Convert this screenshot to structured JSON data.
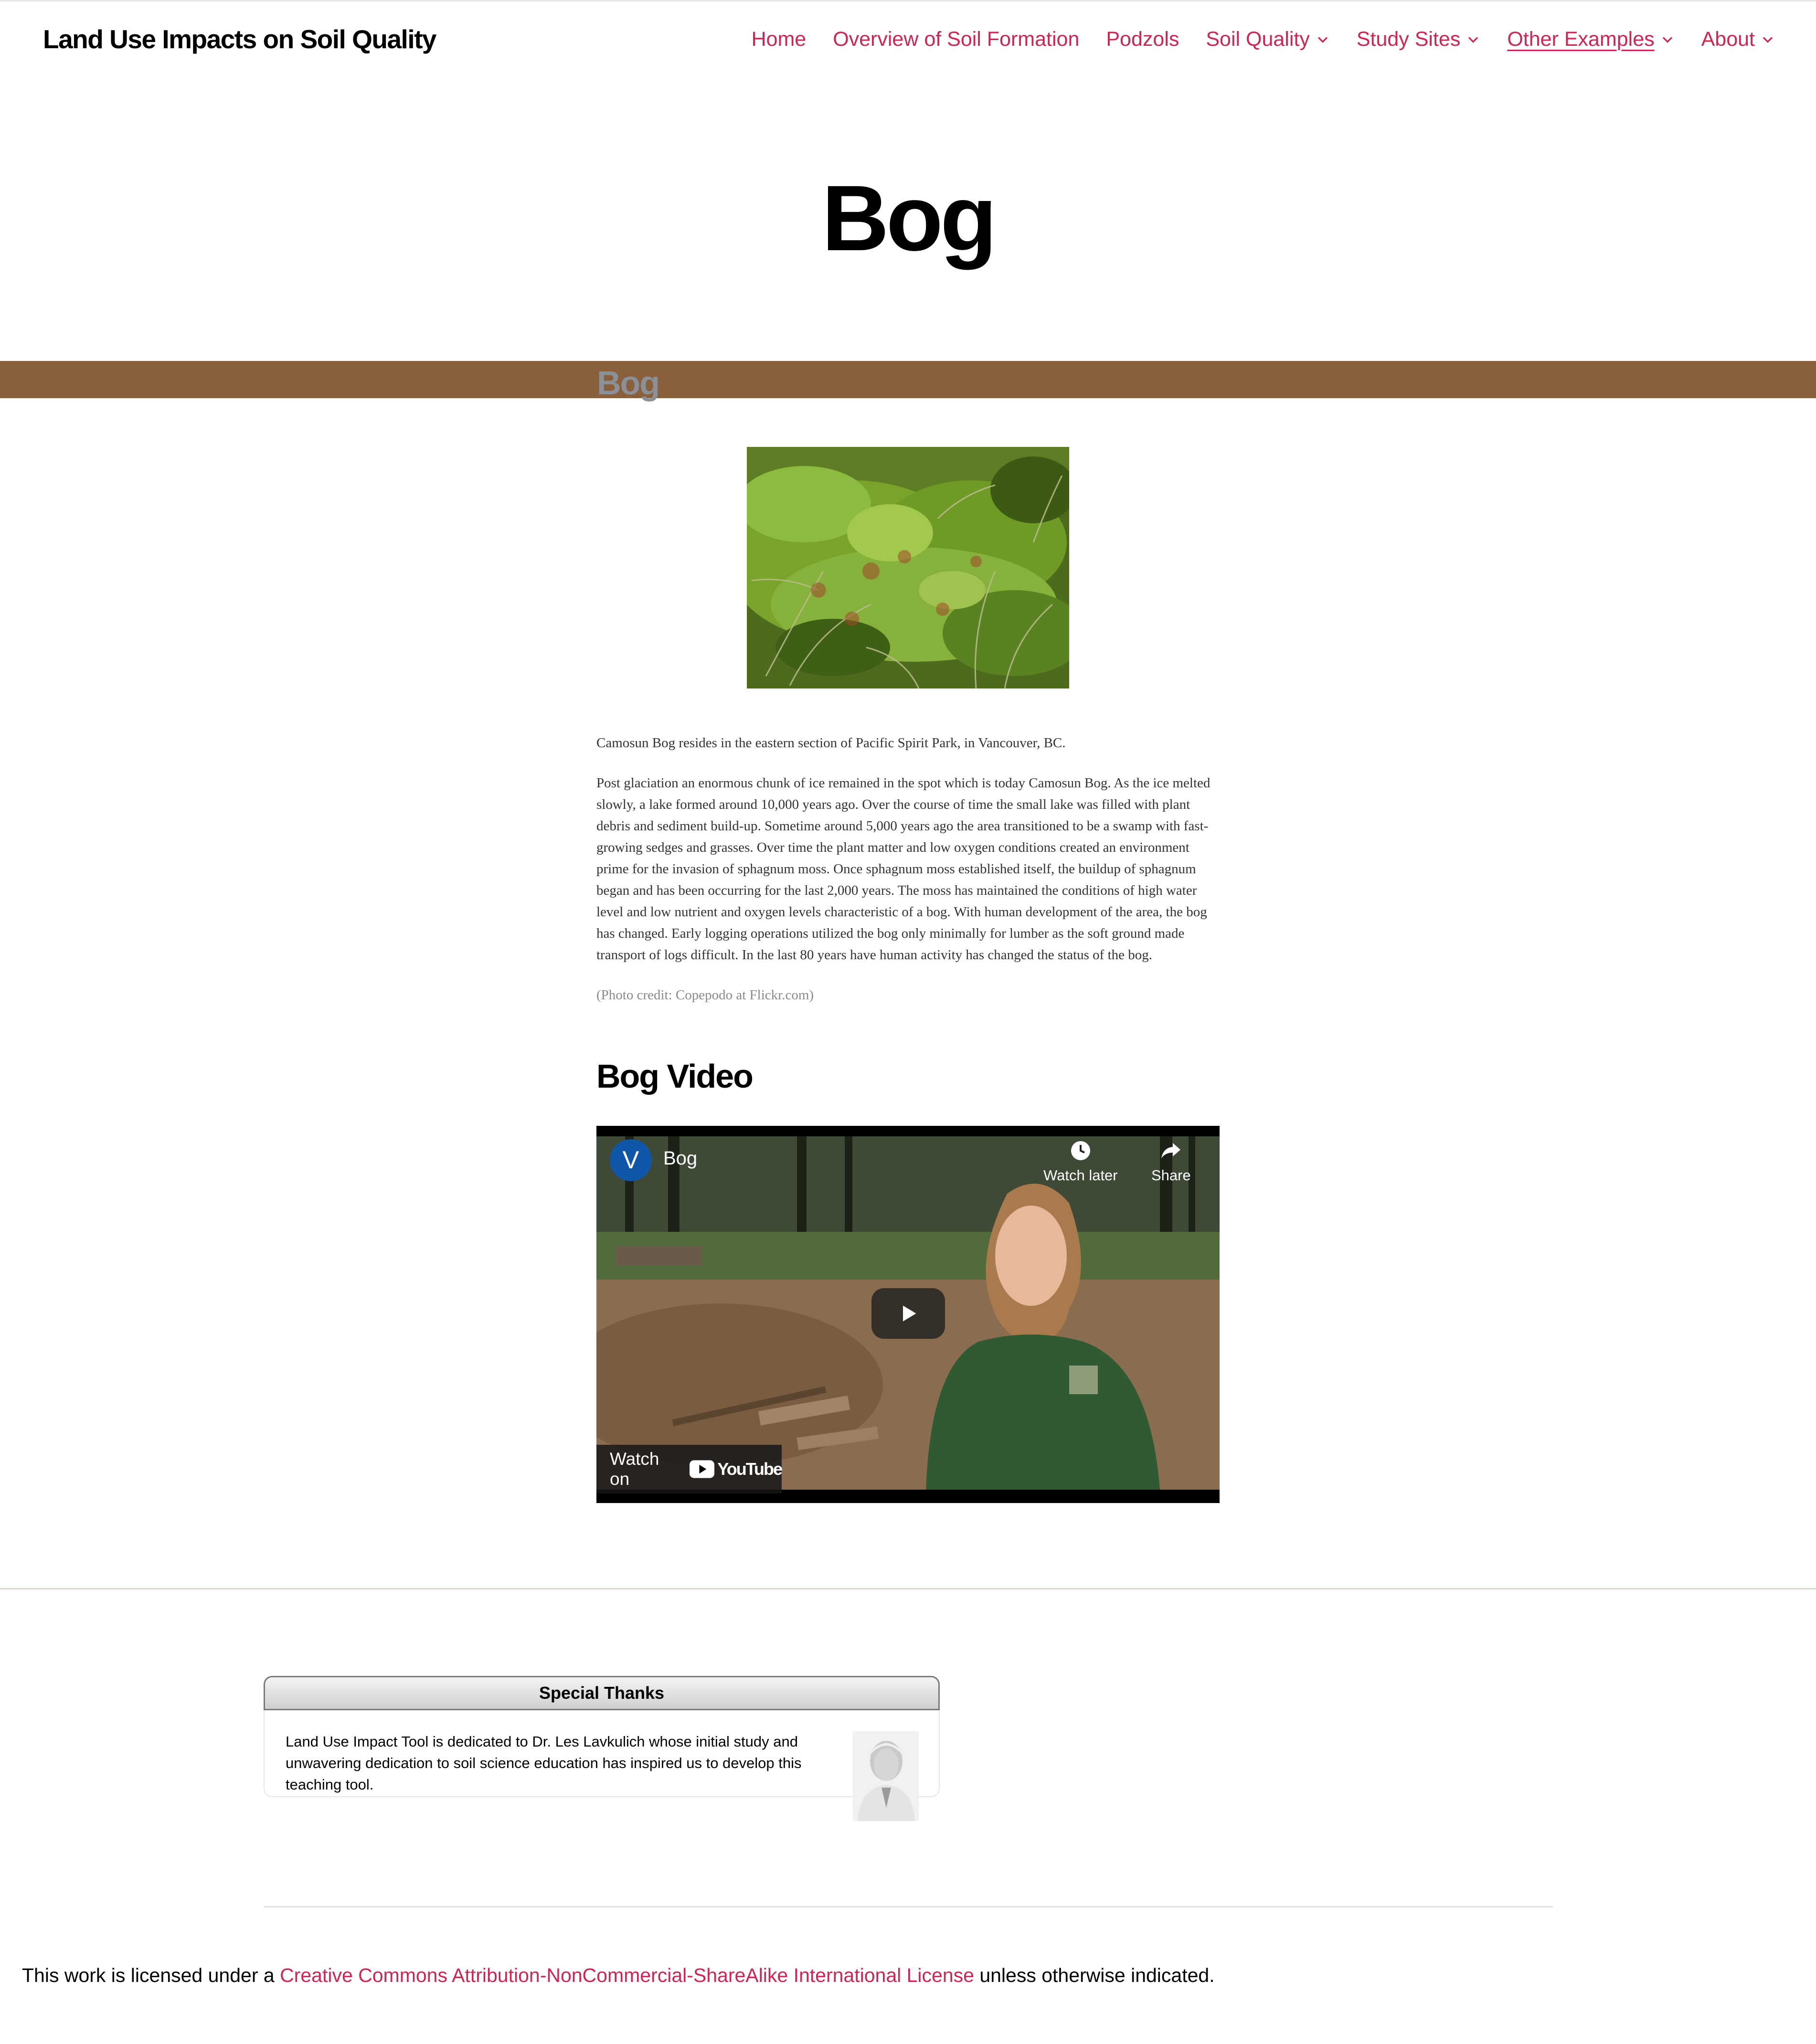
{
  "site": {
    "title": "Land Use Impacts on Soil Quality"
  },
  "nav": {
    "items": [
      {
        "label": "Home",
        "has_dropdown": false
      },
      {
        "label": "Overview of Soil Formation",
        "has_dropdown": false
      },
      {
        "label": "Podzols",
        "has_dropdown": false
      },
      {
        "label": "Soil Quality",
        "has_dropdown": true
      },
      {
        "label": "Study Sites",
        "has_dropdown": true
      },
      {
        "label": "Other Examples",
        "has_dropdown": true,
        "active": true
      },
      {
        "label": "About",
        "has_dropdown": true
      }
    ],
    "accent_color": "#cd2653"
  },
  "page": {
    "title": "Bog",
    "band_heading": "Bog",
    "band_color": "#8a5f3b"
  },
  "content": {
    "p1": "Camosun Bog resides in the eastern section of Pacific Spirit Park, in Vancouver, BC.",
    "p2": "Post glaciation an enormous chunk of ice remained in the spot which is today Camosun Bog. As the ice melted slowly, a lake formed around 10,000 years ago. Over the course of time the small lake was filled with plant debris and sediment build-up.  Sometime around 5,000 years ago the area transitioned to be a swamp with fast-growing sedges and grasses. Over time the plant matter and low oxygen conditions created an environment prime for the invasion of sphagnum moss. Once sphagnum moss established itself, the buildup of sphagnum began and has been occurring for the last 2,000 years.  The moss has maintained the conditions of high water level and low nutrient and oxygen levels characteristic of a bog. With human development of the area, the bog has changed.  Early logging operations utilized the bog only minimally for lumber as the soft ground made transport of logs difficult.  In the last 80 years have human activity has changed the status of the bog.",
    "photo_credit": "(Photo credit: Copepodo at Flickr.com)",
    "video_heading": "Bog Video"
  },
  "video": {
    "channel_initial": "V",
    "title": "Bog",
    "watch_later": "Watch later",
    "share": "Share",
    "watch_on": "Watch on",
    "platform": "YouTube"
  },
  "footer": {
    "thanks_title": "Special Thanks",
    "thanks_text": "Land Use Impact Tool is dedicated to Dr. Les Lavkulich whose initial study and unwavering dedication to soil science education has inspired us to develop this teaching tool.",
    "license_prefix": "This work is licensed under a ",
    "license_link": "Creative Commons Attribution-NonCommercial-ShareAlike International License",
    "license_suffix": " unless otherwise indicated."
  }
}
